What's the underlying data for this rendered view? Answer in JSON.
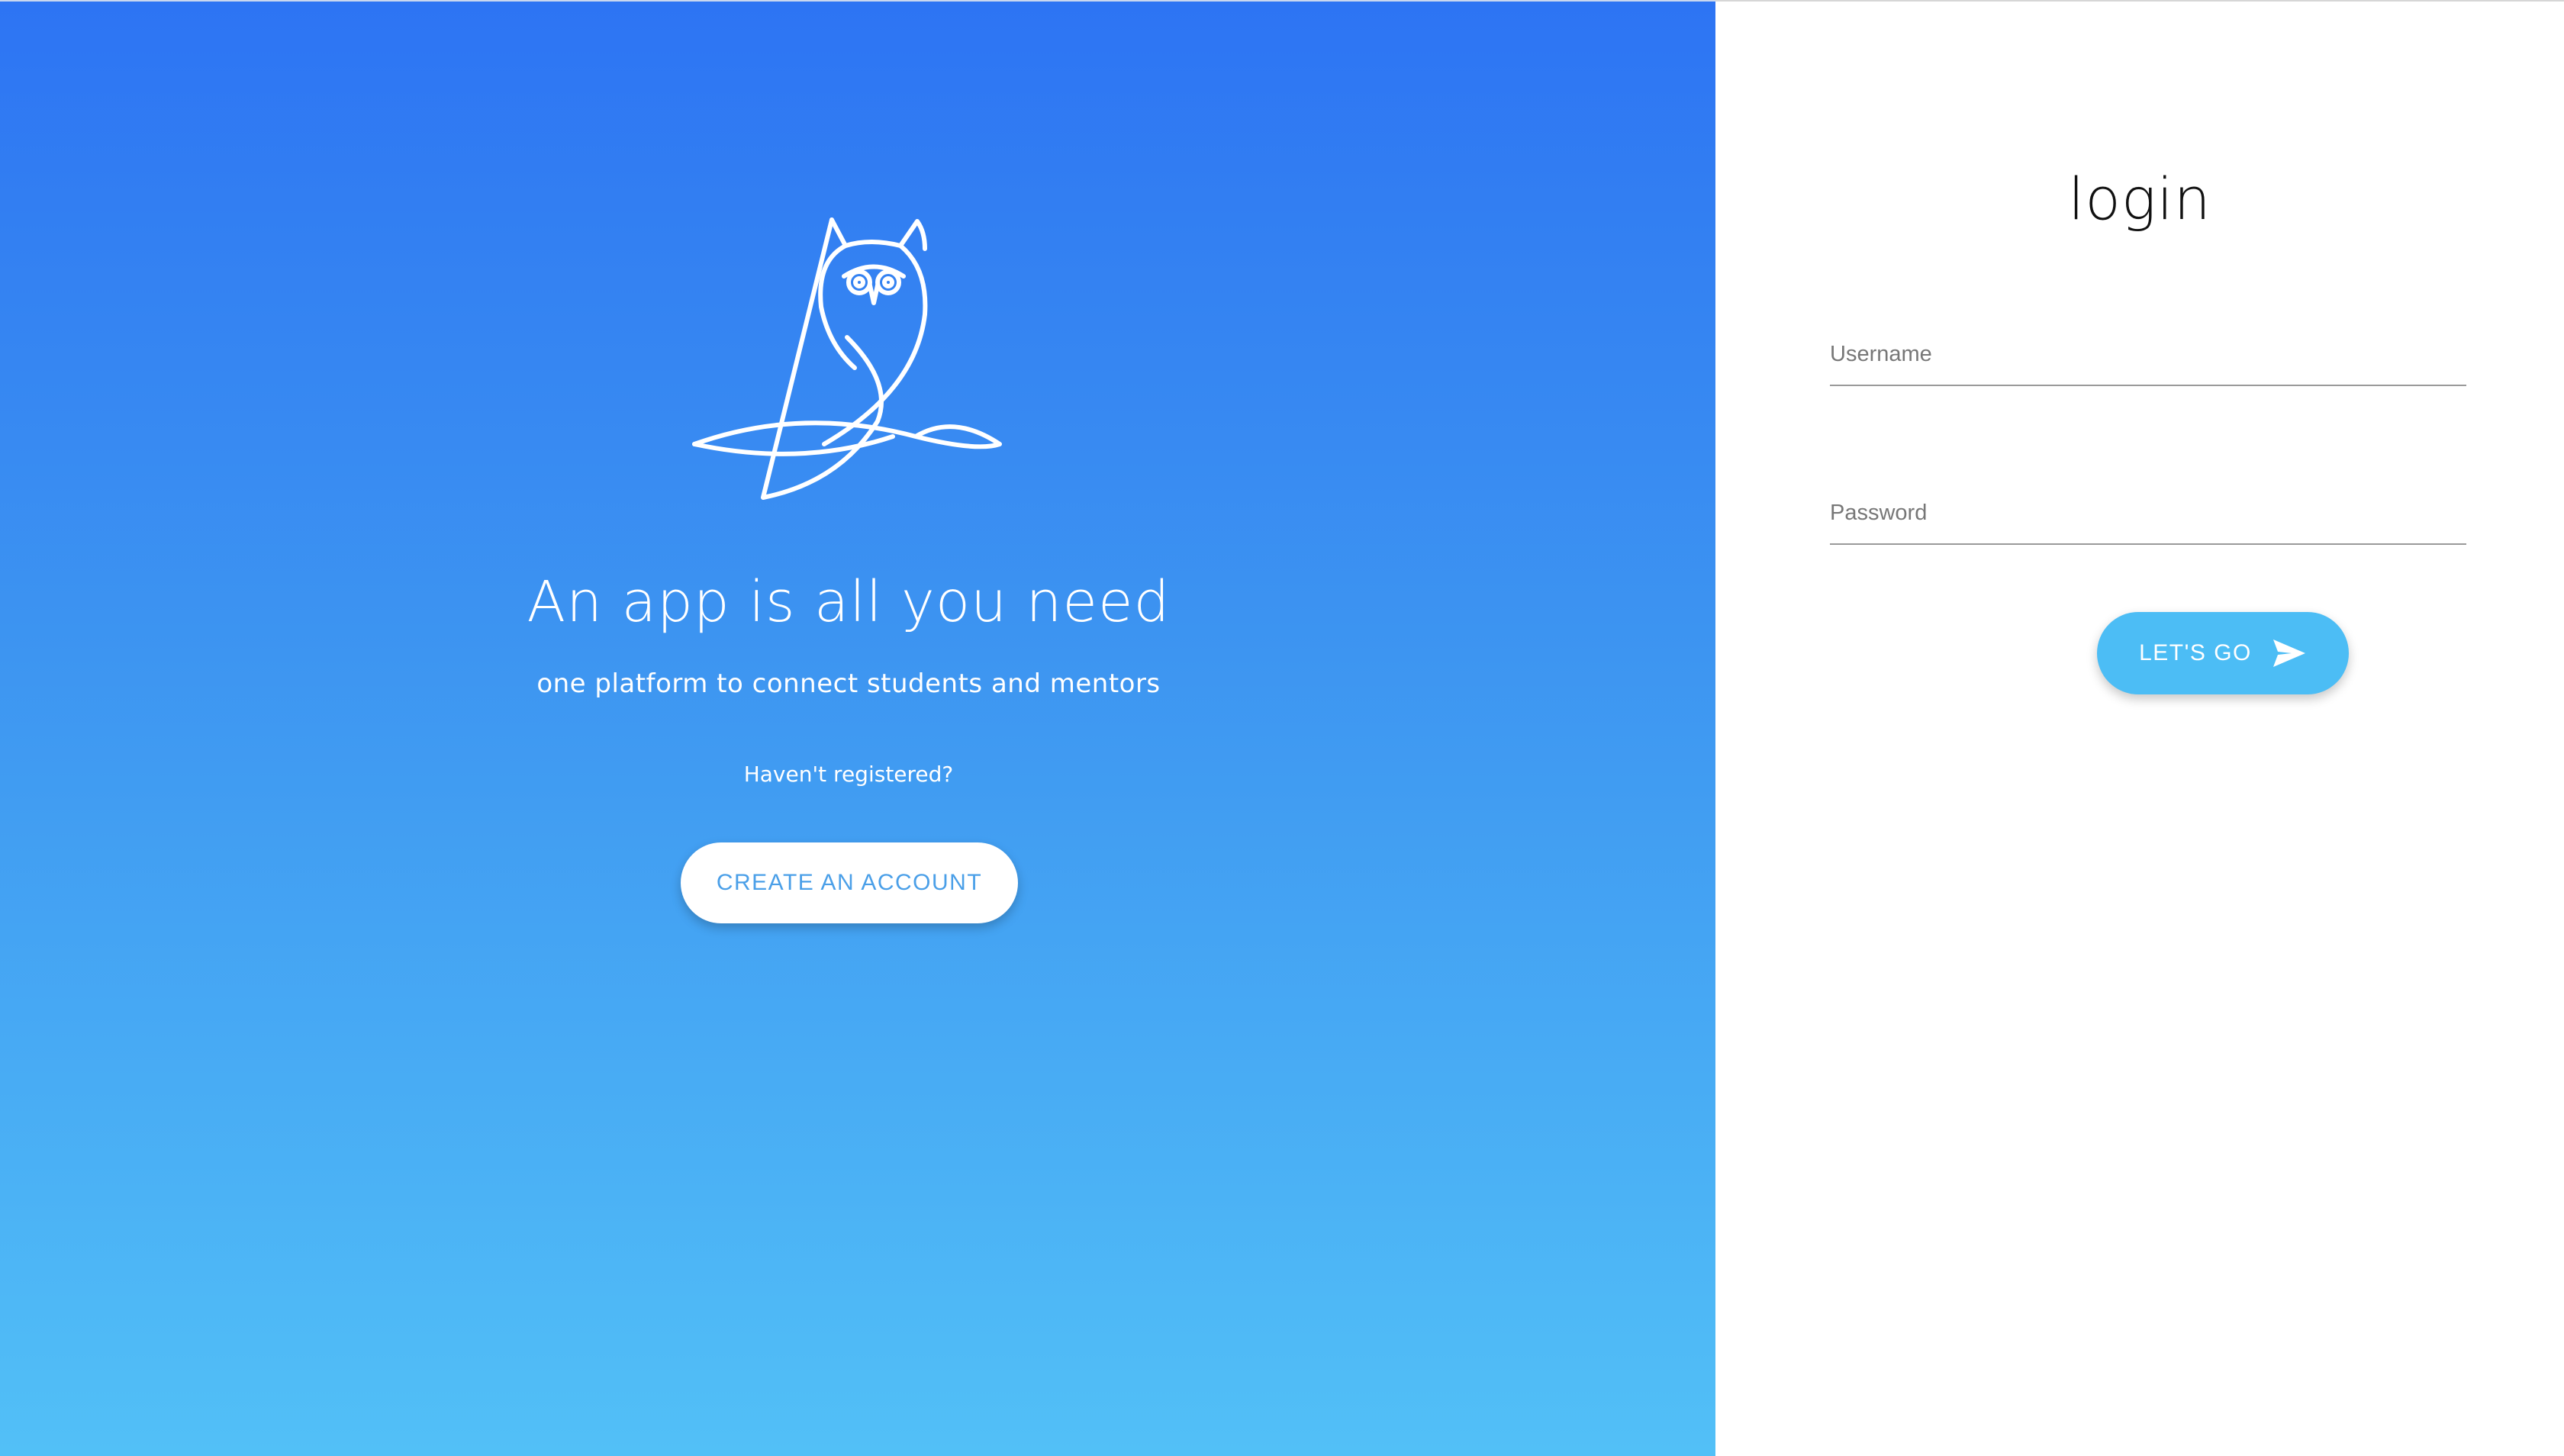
{
  "hero": {
    "logo_icon": "owl-icon",
    "title": "An app is all you need",
    "subtitle": "one platform to connect students and mentors",
    "question": "Haven't registered?",
    "create_account_label": "CREATE AN ACCOUNT"
  },
  "login": {
    "title": "login",
    "username": {
      "placeholder": "Username",
      "value": ""
    },
    "password": {
      "placeholder": "Password",
      "value": ""
    },
    "submit_label": "LET'S GO",
    "submit_icon": "send-icon"
  },
  "colors": {
    "gradient_top": "#2d74f3",
    "gradient_bottom": "#52c0f7",
    "create_button_text": "#4a9fe8",
    "submit_button": "#4cbdf5"
  }
}
